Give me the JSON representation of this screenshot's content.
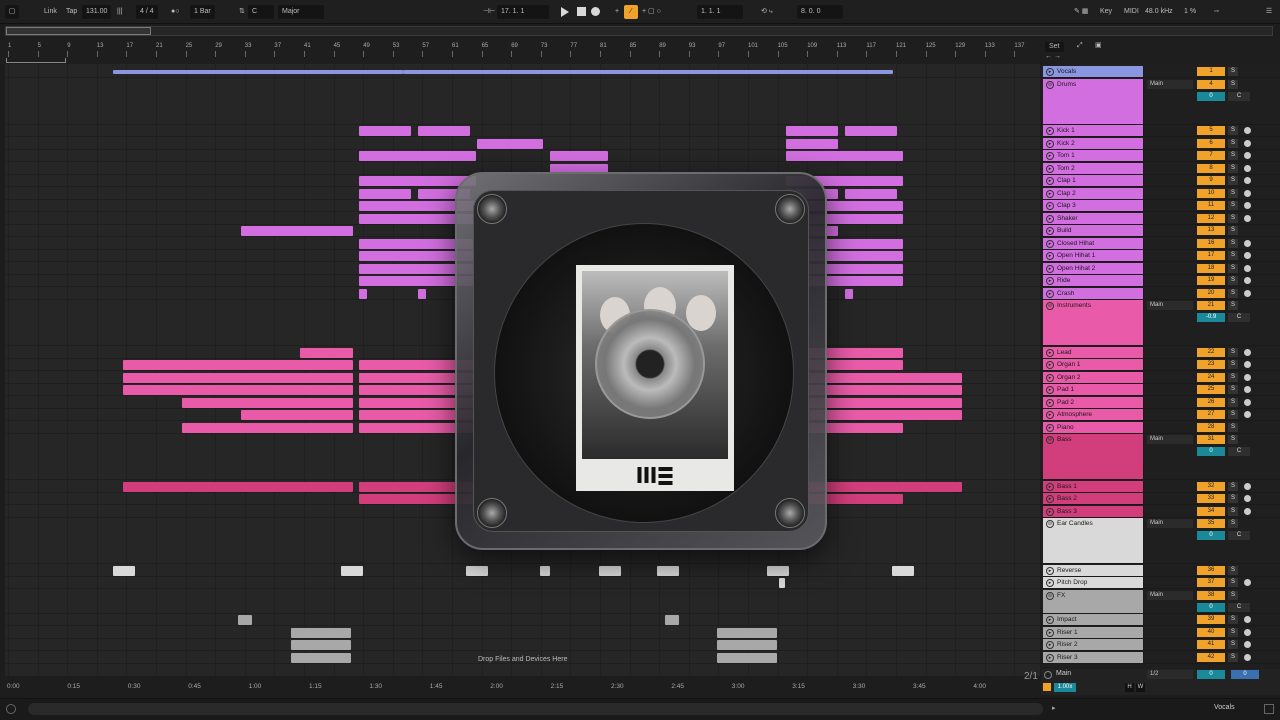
{
  "toolbar": {
    "link": "Link",
    "tap": "Tap",
    "tempo": "131.00",
    "time_sig": "4 / 4",
    "quantize": "1 Bar",
    "key_root": "C",
    "scale": "Major",
    "position": "17.  1.  1",
    "loop_start": "1.  1.  1",
    "loop_length": "8.  0.  0",
    "key_label": "Key",
    "midi_label": "MIDI",
    "sample_rate": "48.0 kHz",
    "cpu": "1 %"
  },
  "ruler": {
    "bars": [
      "1",
      "5",
      "9",
      "13",
      "17",
      "21",
      "25",
      "29",
      "33",
      "37",
      "41",
      "45",
      "49",
      "53",
      "57",
      "61",
      "65",
      "69",
      "73",
      "77",
      "81",
      "85",
      "89",
      "93",
      "97",
      "101",
      "105",
      "109",
      "113",
      "117",
      "121",
      "125",
      "129",
      "133",
      "137"
    ],
    "set_label": "Set"
  },
  "time_ruler": [
    "0:00",
    "0:15",
    "0:30",
    "0:45",
    "1:00",
    "1:15",
    "1:30",
    "1:45",
    "2:00",
    "2:15",
    "2:30",
    "2:45",
    "3:00",
    "3:15",
    "3:30",
    "3:45",
    "4:00"
  ],
  "drop_text": "Drop Files and Devices Here",
  "page_indicator": "2/1",
  "tracks": [
    {
      "name": "Vocals",
      "num": "1",
      "color": "#8a96e0"
    },
    {
      "name": "Drums",
      "num": "4",
      "route": "Main",
      "vol": "0",
      "color": "#d26ee0",
      "group": true
    },
    {
      "name": "Kick 1",
      "num": "5",
      "color": "#d26ee0"
    },
    {
      "name": "Kick 2",
      "num": "6",
      "color": "#d26ee0"
    },
    {
      "name": "Tom 1",
      "num": "7",
      "color": "#d26ee0"
    },
    {
      "name": "Tom 2",
      "num": "8",
      "color": "#d26ee0"
    },
    {
      "name": "Clap 1",
      "num": "9",
      "color": "#d26ee0"
    },
    {
      "name": "Clap 2",
      "num": "10",
      "color": "#d26ee0"
    },
    {
      "name": "Clap 3",
      "num": "11",
      "color": "#d26ee0"
    },
    {
      "name": "Shaker",
      "num": "12",
      "color": "#d26ee0"
    },
    {
      "name": "Build",
      "num": "13",
      "color": "#d26ee0"
    },
    {
      "name": "Closed Hihat",
      "num": "16",
      "color": "#d26ee0"
    },
    {
      "name": "Open Hihat 1",
      "num": "17",
      "color": "#d26ee0"
    },
    {
      "name": "Open Hihat 2",
      "num": "18",
      "color": "#d26ee0"
    },
    {
      "name": "Ride",
      "num": "19",
      "color": "#d26ee0"
    },
    {
      "name": "Crash",
      "num": "20",
      "color": "#d26ee0"
    },
    {
      "name": "Instruments",
      "num": "21",
      "route": "Main",
      "vol": "-0.9",
      "color": "#e95ba8",
      "group": true
    },
    {
      "name": "Lead",
      "num": "22",
      "color": "#e95ba8"
    },
    {
      "name": "Organ 1",
      "num": "23",
      "color": "#e95ba8"
    },
    {
      "name": "Organ 2",
      "num": "24",
      "color": "#e95ba8"
    },
    {
      "name": "Pad 1",
      "num": "25",
      "color": "#e95ba8"
    },
    {
      "name": "Pad 2",
      "num": "26",
      "color": "#e95ba8"
    },
    {
      "name": "Atmosphere",
      "num": "27",
      "color": "#e95ba8"
    },
    {
      "name": "Piano",
      "num": "28",
      "color": "#e95ba8"
    },
    {
      "name": "Bass",
      "num": "31",
      "route": "Main",
      "vol": "0",
      "color": "#d23e7c",
      "group": true
    },
    {
      "name": "Bass 1",
      "num": "32",
      "color": "#d23e7c"
    },
    {
      "name": "Bass 2",
      "num": "33",
      "color": "#d23e7c"
    },
    {
      "name": "Bass 3",
      "num": "34",
      "color": "#d23e7c"
    },
    {
      "name": "Ear Candles",
      "num": "35",
      "route": "Main",
      "vol": "0",
      "color": "#d9d9d9",
      "group": true
    },
    {
      "name": "Reverse",
      "num": "36",
      "color": "#d9d9d9"
    },
    {
      "name": "Pitch Drop",
      "num": "37",
      "color": "#d9d9d9"
    },
    {
      "name": "FX",
      "num": "38",
      "route": "Main",
      "vol": "0",
      "color": "#a8a8a8",
      "group": true
    },
    {
      "name": "Impact",
      "num": "39",
      "color": "#a8a8a8"
    },
    {
      "name": "Riser 1",
      "num": "40",
      "color": "#a8a8a8"
    },
    {
      "name": "Riser 2",
      "num": "41",
      "color": "#a8a8a8"
    },
    {
      "name": "Riser 3",
      "num": "42",
      "color": "#a8a8a8"
    }
  ],
  "main": {
    "name": "Main",
    "route": "1/2",
    "vol": "0",
    "zoom": "1.00x"
  },
  "status": {
    "track": "Vocals",
    "h": "H",
    "w": "W"
  }
}
